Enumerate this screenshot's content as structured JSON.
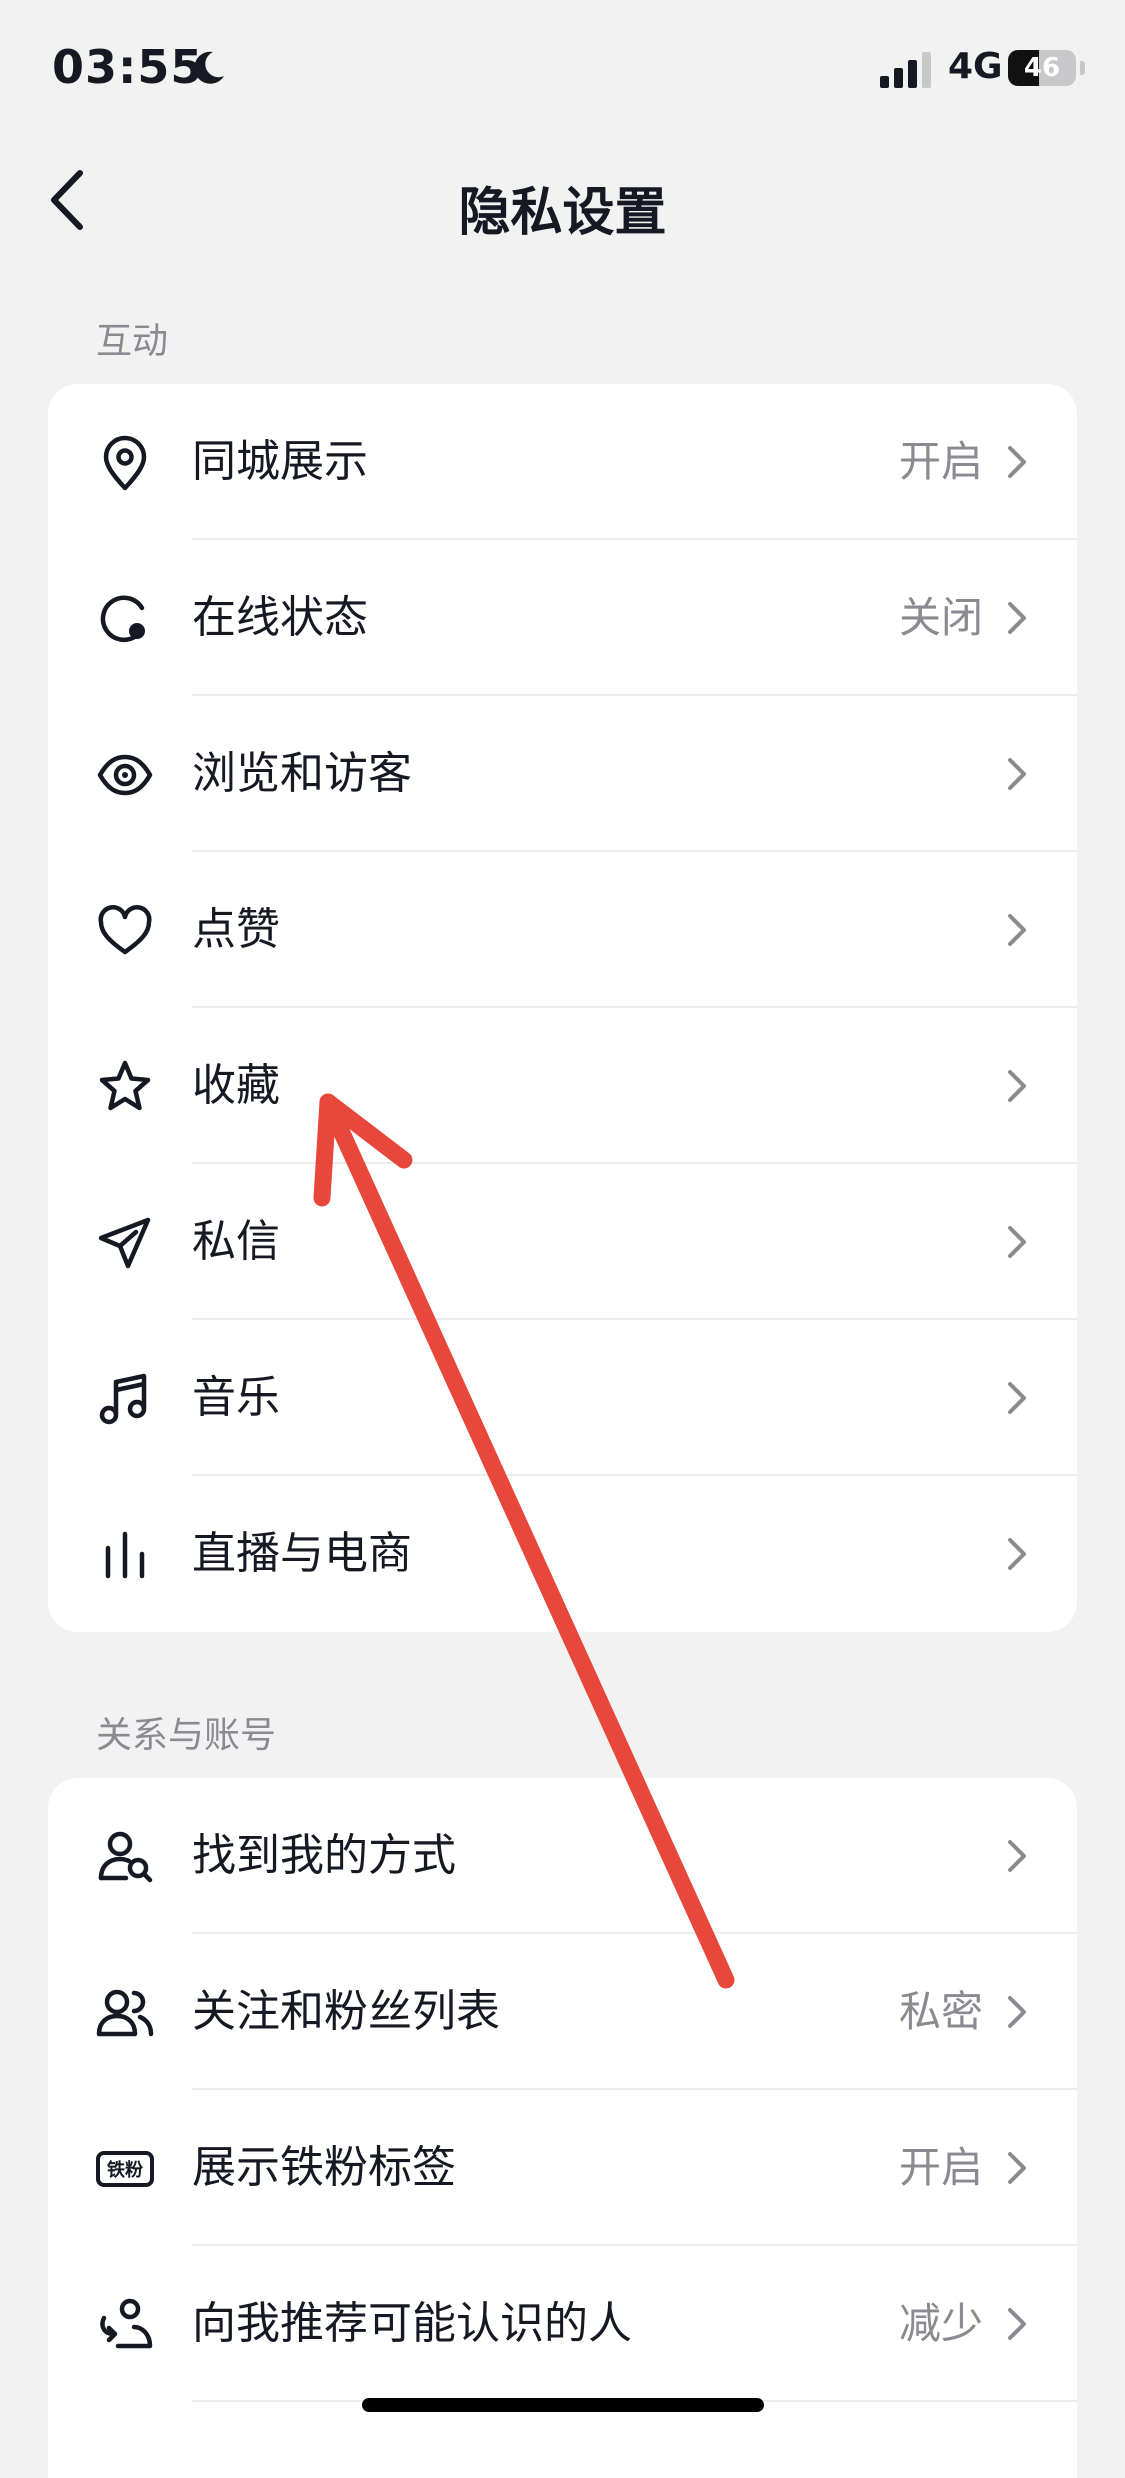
{
  "status_bar": {
    "time": "03:55",
    "network": "4G",
    "battery": "46",
    "battery_level": 0.46
  },
  "nav": {
    "title": "隐私设置"
  },
  "sections": [
    {
      "header": "互动",
      "items": [
        {
          "icon": "location-pin-icon",
          "label": "同城展示",
          "value": "开启"
        },
        {
          "icon": "online-status-icon",
          "label": "在线状态",
          "value": "关闭"
        },
        {
          "icon": "eye-icon",
          "label": "浏览和访客",
          "value": ""
        },
        {
          "icon": "heart-icon",
          "label": "点赞",
          "value": ""
        },
        {
          "icon": "star-icon",
          "label": "收藏",
          "value": ""
        },
        {
          "icon": "paper-plane-icon",
          "label": "私信",
          "value": ""
        },
        {
          "icon": "music-note-icon",
          "label": "音乐",
          "value": ""
        },
        {
          "icon": "live-bars-icon",
          "label": "直播与电商",
          "value": ""
        }
      ]
    },
    {
      "header": "关系与账号",
      "items": [
        {
          "icon": "person-search-icon",
          "label": "找到我的方式",
          "value": ""
        },
        {
          "icon": "users-icon",
          "label": "关注和粉丝列表",
          "value": "私密"
        },
        {
          "icon": "iron-fan-badge-icon",
          "label": "展示铁粉标签",
          "value": "开启",
          "badge_text": "铁粉"
        },
        {
          "icon": "recommend-people-icon",
          "label": "向我推荐可能认识的人",
          "value": "减少"
        }
      ]
    }
  ],
  "colors": {
    "background": "#f2f2f3",
    "card": "#ffffff",
    "secondary_text": "#8a8b91",
    "annotation_arrow": "#e8483c"
  }
}
